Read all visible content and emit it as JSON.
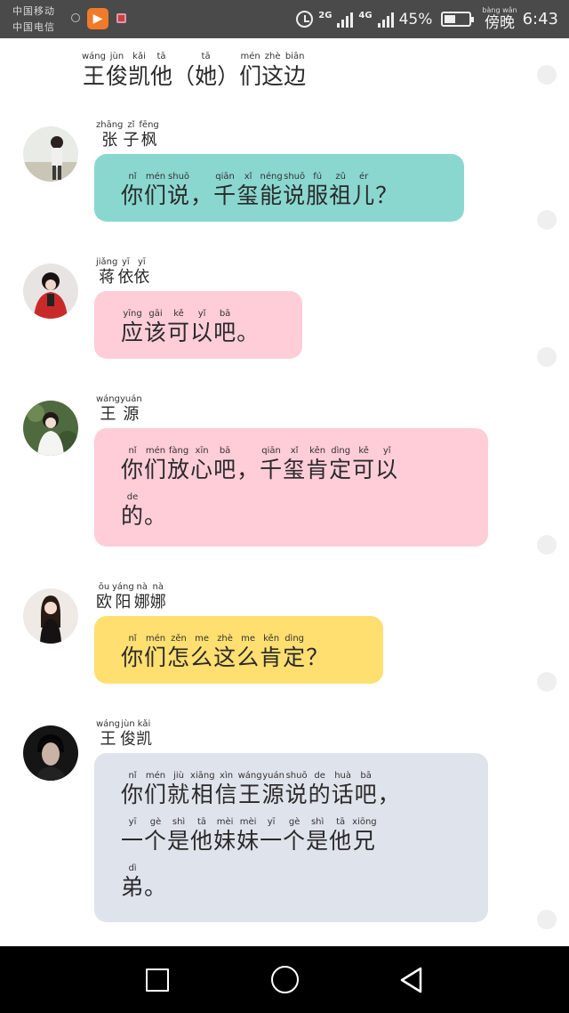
{
  "statusbar": {
    "carrier_1": "中国移动",
    "carrier_2": "中国电信",
    "network_1": "2G",
    "network_2": "4G",
    "battery_percent": "45%",
    "battery_level": 0.45,
    "time_period": "傍晚",
    "time_period_pinyin": "bàng wǎn",
    "time": "6:43"
  },
  "header": {
    "words": [
      {
        "py": "wáng",
        "hz": "王"
      },
      {
        "py": "jùn",
        "hz": "俊"
      },
      {
        "py": "kǎi",
        "hz": "凯"
      },
      {
        "py": "tā",
        "hz": "他"
      },
      {
        "py": "",
        "hz": "（"
      },
      {
        "py": "tā",
        "hz": "她"
      },
      {
        "py": "",
        "hz": "）"
      },
      {
        "py": "mén",
        "hz": "们"
      },
      {
        "py": "zhè",
        "hz": "这"
      },
      {
        "py": "biān",
        "hz": "边"
      }
    ]
  },
  "messages": [
    {
      "name": [
        {
          "py": "zhāng",
          "hz": "张"
        },
        {
          "py": "zǐ",
          "hz": "子"
        },
        {
          "py": "fēng",
          "hz": "枫"
        }
      ],
      "lines": [
        [
          {
            "py": "nǐ",
            "hz": "你"
          },
          {
            "py": "mén",
            "hz": "们"
          },
          {
            "py": "shuō",
            "hz": "说"
          },
          {
            "py": "",
            "hz": "，"
          },
          {
            "py": "qiān",
            "hz": "千"
          },
          {
            "py": "xǐ",
            "hz": "玺"
          },
          {
            "py": "néng",
            "hz": "能"
          },
          {
            "py": "shuō",
            "hz": "说"
          },
          {
            "py": "fú",
            "hz": "服"
          },
          {
            "py": "zǔ",
            "hz": "祖"
          },
          {
            "py": "ér",
            "hz": "儿"
          },
          {
            "py": "",
            "hz": "？"
          }
        ]
      ]
    },
    {
      "name": [
        {
          "py": "jiǎng",
          "hz": "蒋"
        },
        {
          "py": "yī",
          "hz": "依"
        },
        {
          "py": "yī",
          "hz": "依"
        }
      ],
      "lines": [
        [
          {
            "py": "yīng",
            "hz": "应"
          },
          {
            "py": "gāi",
            "hz": "该"
          },
          {
            "py": "kě",
            "hz": "可"
          },
          {
            "py": "yǐ",
            "hz": "以"
          },
          {
            "py": "bā",
            "hz": "吧"
          },
          {
            "py": "",
            "hz": "。"
          }
        ]
      ]
    },
    {
      "name": [
        {
          "py": "wáng",
          "hz": "王"
        },
        {
          "py": "yuán",
          "hz": "源"
        }
      ],
      "lines": [
        [
          {
            "py": "nǐ",
            "hz": "你"
          },
          {
            "py": "mén",
            "hz": "们"
          },
          {
            "py": "fàng",
            "hz": "放"
          },
          {
            "py": "xīn",
            "hz": "心"
          },
          {
            "py": "bā",
            "hz": "吧"
          },
          {
            "py": "",
            "hz": "，"
          },
          {
            "py": "qiān",
            "hz": "千"
          },
          {
            "py": "xǐ",
            "hz": "玺"
          },
          {
            "py": "kěn",
            "hz": "肯"
          },
          {
            "py": "dìng",
            "hz": "定"
          },
          {
            "py": "kě",
            "hz": "可"
          },
          {
            "py": "yǐ",
            "hz": "以"
          }
        ],
        [
          {
            "py": "de",
            "hz": "的"
          },
          {
            "py": "",
            "hz": "。"
          }
        ]
      ]
    },
    {
      "name": [
        {
          "py": "ōu",
          "hz": "欧"
        },
        {
          "py": "yáng",
          "hz": "阳"
        },
        {
          "py": "nà",
          "hz": "娜"
        },
        {
          "py": "nà",
          "hz": "娜"
        }
      ],
      "lines": [
        [
          {
            "py": "nǐ",
            "hz": "你"
          },
          {
            "py": "mén",
            "hz": "们"
          },
          {
            "py": "zěn",
            "hz": "怎"
          },
          {
            "py": "me",
            "hz": "么"
          },
          {
            "py": "zhè",
            "hz": "这"
          },
          {
            "py": "me",
            "hz": "么"
          },
          {
            "py": "kěn",
            "hz": "肯"
          },
          {
            "py": "dìng",
            "hz": "定"
          },
          {
            "py": "",
            "hz": "？"
          }
        ]
      ]
    },
    {
      "name": [
        {
          "py": "wáng",
          "hz": "王"
        },
        {
          "py": "jùn",
          "hz": "俊"
        },
        {
          "py": "kǎi",
          "hz": "凯"
        }
      ],
      "lines": [
        [
          {
            "py": "nǐ",
            "hz": "你"
          },
          {
            "py": "mén",
            "hz": "们"
          },
          {
            "py": "jiù",
            "hz": "就"
          },
          {
            "py": "xiāng",
            "hz": "相"
          },
          {
            "py": "xìn",
            "hz": "信"
          },
          {
            "py": "wáng",
            "hz": "王"
          },
          {
            "py": "yuán",
            "hz": "源"
          },
          {
            "py": "shuō",
            "hz": "说"
          },
          {
            "py": "de",
            "hz": "的"
          },
          {
            "py": "huà",
            "hz": "话"
          },
          {
            "py": "bā",
            "hz": "吧"
          },
          {
            "py": "",
            "hz": "，"
          }
        ],
        [
          {
            "py": "yī",
            "hz": "一"
          },
          {
            "py": "gè",
            "hz": "个"
          },
          {
            "py": "shì",
            "hz": "是"
          },
          {
            "py": "tā",
            "hz": "他"
          },
          {
            "py": "mèi",
            "hz": "妹"
          },
          {
            "py": "mèi",
            "hz": "妹"
          },
          {
            "py": "yī",
            "hz": "一"
          },
          {
            "py": "gè",
            "hz": "个"
          },
          {
            "py": "shì",
            "hz": "是"
          },
          {
            "py": "tā",
            "hz": "他"
          },
          {
            "py": "xiōng",
            "hz": "兄"
          }
        ],
        [
          {
            "py": "dì",
            "hz": "弟"
          },
          {
            "py": "",
            "hz": "。"
          }
        ]
      ]
    }
  ],
  "colors": {
    "statusbar_bg": "#4a4a4a",
    "bubble_teal": "#8ad7d0",
    "bubble_pink": "#ffcdd8",
    "bubble_yellow": "#ffdf70",
    "bubble_gray": "#dfe3ec",
    "navbar_bg": "#000000"
  },
  "navbar": {
    "icons": [
      "square-recents-icon",
      "circle-home-icon",
      "triangle-back-icon"
    ]
  }
}
